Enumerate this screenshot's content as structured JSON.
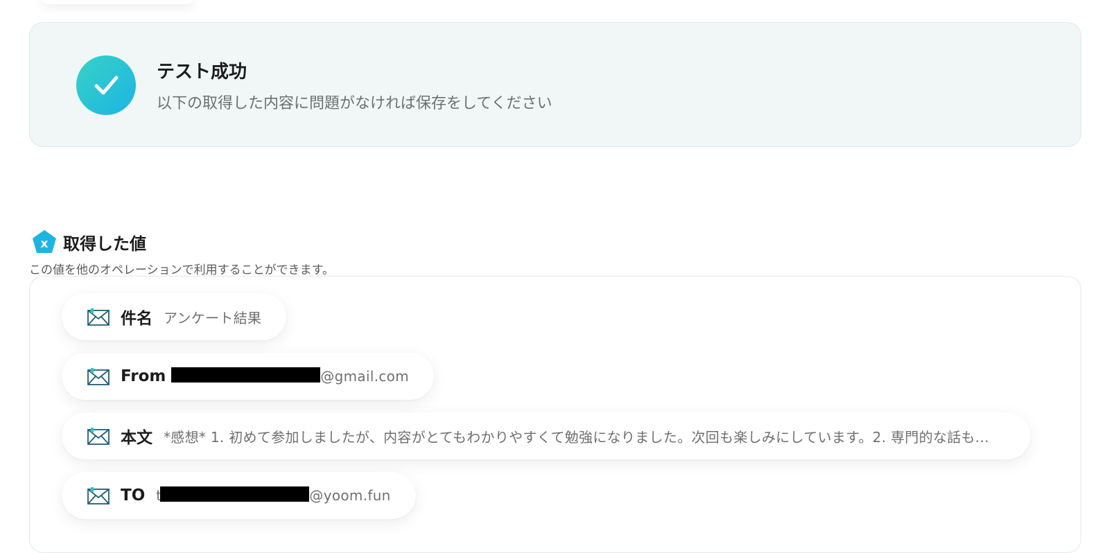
{
  "success": {
    "title": "テスト成功",
    "subtitle": "以下の取得した内容に問題がなければ保存をしてください"
  },
  "values_section": {
    "title": "取得した値",
    "description": "この値を他のオペレーションで利用することができます。"
  },
  "fields": [
    {
      "label": "件名",
      "value": "アンケート結果"
    },
    {
      "label": "From",
      "value_suffix": "@gmail.com"
    },
    {
      "label": "本文",
      "value": "*感想* 1. 初めて参加しましたが、内容がとてもわかりやすくて勉強になりました。次回も楽しみにしています。2. 専門的な話も..."
    },
    {
      "label": "TO",
      "value_prefix": "t",
      "value_suffix": "@yoom.fun"
    }
  ],
  "colors": {
    "accent": "#1db4e4",
    "accent_teal": "#36d3c6",
    "icon_stroke": "#1f5d78"
  },
  "icons": {
    "success": "check-circle-icon",
    "section": "yoom-logo-icon",
    "field": "mail-icon"
  }
}
